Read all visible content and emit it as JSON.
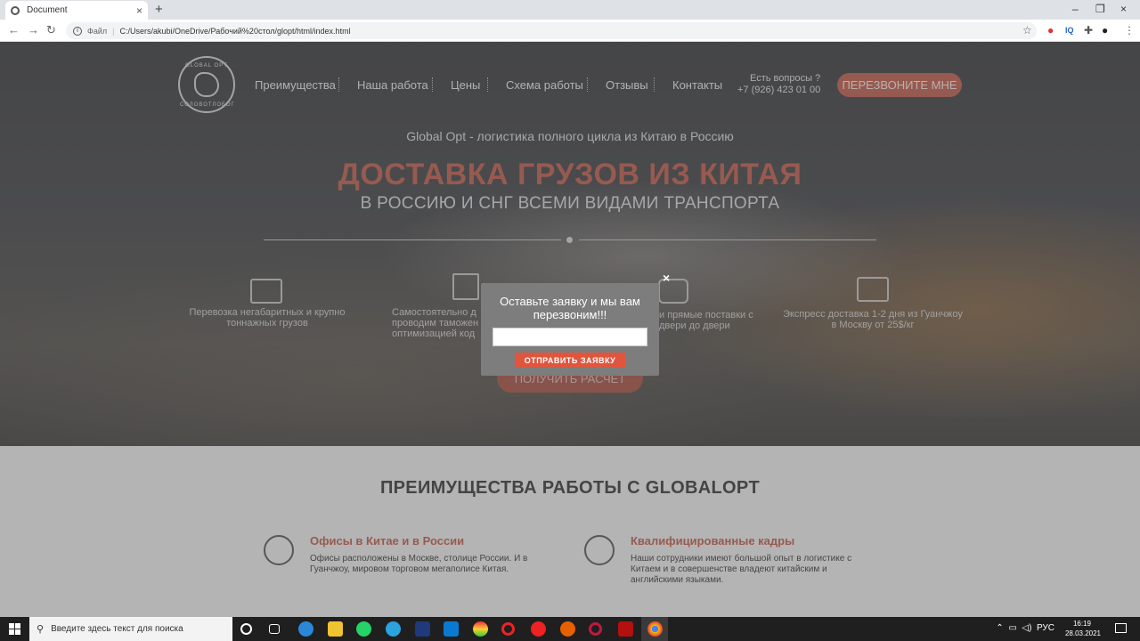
{
  "browser": {
    "tab_title": "Document",
    "tab_close": "×",
    "new_tab": "+",
    "address_label": "Файл",
    "address_url": "C:/Users/akubi/OneDrive/Рабочий%20стол/glopt/html/index.html",
    "window_controls": [
      "–",
      "❐",
      "×"
    ],
    "ext_iq": "IQ"
  },
  "site": {
    "logo_top": "GLOBAL OPT",
    "logo_bottom": "СОЛОВОТЛОБОГ",
    "nav": [
      "Преимущества",
      "Наша работа",
      "Цены",
      "Схема работы",
      "Отзывы",
      "Контакты"
    ],
    "phone_question": "Есть вопросы ?",
    "phone_number": "+7 (926) 423 01 00",
    "callback_button": "ПЕРЕЗВОНИТЕ МНЕ",
    "subtitle": "Global Opt - логистика полного цикла из Китаю в Россию",
    "headline": "ДОСТАВКА ГРУЗОВ ИЗ КИТАЯ",
    "headline2": "В РОССИЮ И СНГ ВСЕМИ ВИДАМИ ТРАНСПОРТА",
    "features": [
      {
        "line1": "Перевозка негабаритных и крупно",
        "line2": "тоннажных грузов"
      },
      {
        "line1": "Самостоятельно д",
        "line2": "проводим таможен",
        "line3": "оптимизацией код"
      },
      {
        "line1": "и прямые поставки с",
        "line2": "двери до двери"
      },
      {
        "line1": "Экспресс доставка 1-2 дня из Гуанчжоу",
        "line2": "в Москву от 25$/кг"
      }
    ],
    "calc_button": "ПОЛУЧИТЬ РАСЧЕТ"
  },
  "advantages": {
    "title": "ПРЕИМУЩЕСТВА РАБОТЫ С GLOBALOPT",
    "items": [
      {
        "heading": "Офисы в Китае и в России",
        "line1": "Офисы расположены в Москве, столице России. И в",
        "line2": "Гуанчжоу, мировом торговом мегаполисе Китая."
      },
      {
        "heading": "Квалифицированные кадры",
        "line1": "Наши сотрудники имеют большой опыт в логистике с",
        "line2": "Китаем и в совершенстве владеют китайским и",
        "line3": "английскими языками."
      }
    ]
  },
  "modal": {
    "close": "×",
    "title_line1": "Оставьте заявку и мы вам",
    "title_line2": "перезвоним!!!",
    "input_value": "",
    "submit": "ОТПРАВИТЬ ЗАЯВКУ"
  },
  "taskbar": {
    "search_placeholder": "Введите здесь текст для поиска",
    "language": "РУС",
    "time": "16:19",
    "date": "28.03.2021"
  }
}
